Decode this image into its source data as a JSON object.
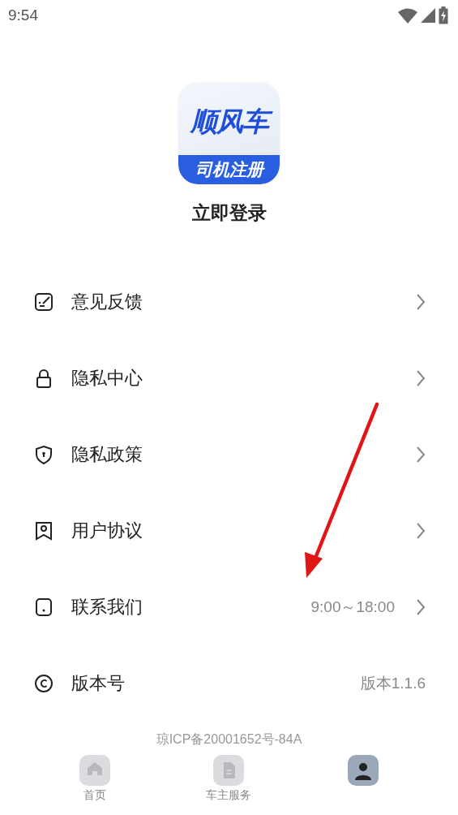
{
  "status_bar": {
    "time": "9:54"
  },
  "logo": {
    "title": "顺风车",
    "subtitle": "司机注册"
  },
  "login": "立即登录",
  "menu": [
    {
      "kind": "feedback",
      "label": "意见反馈",
      "chevron": true
    },
    {
      "kind": "lock",
      "label": "隐私中心",
      "chevron": true
    },
    {
      "kind": "shield",
      "label": "隐私政策",
      "chevron": true
    },
    {
      "kind": "bookmark",
      "label": "用户协议",
      "chevron": true
    },
    {
      "kind": "phone",
      "label": "联系我们",
      "value": "9:00～18:00",
      "chevron": true
    },
    {
      "kind": "copyright",
      "label": "版本号",
      "value": "版本1.1.6",
      "chevron": false
    }
  ],
  "icp": "琼ICP备20001652号-84A",
  "tabs": [
    {
      "kind": "home",
      "label": "首页",
      "selected": false
    },
    {
      "kind": "document",
      "label": "车主服务",
      "selected": false
    },
    {
      "kind": "person",
      "selected": true
    }
  ]
}
